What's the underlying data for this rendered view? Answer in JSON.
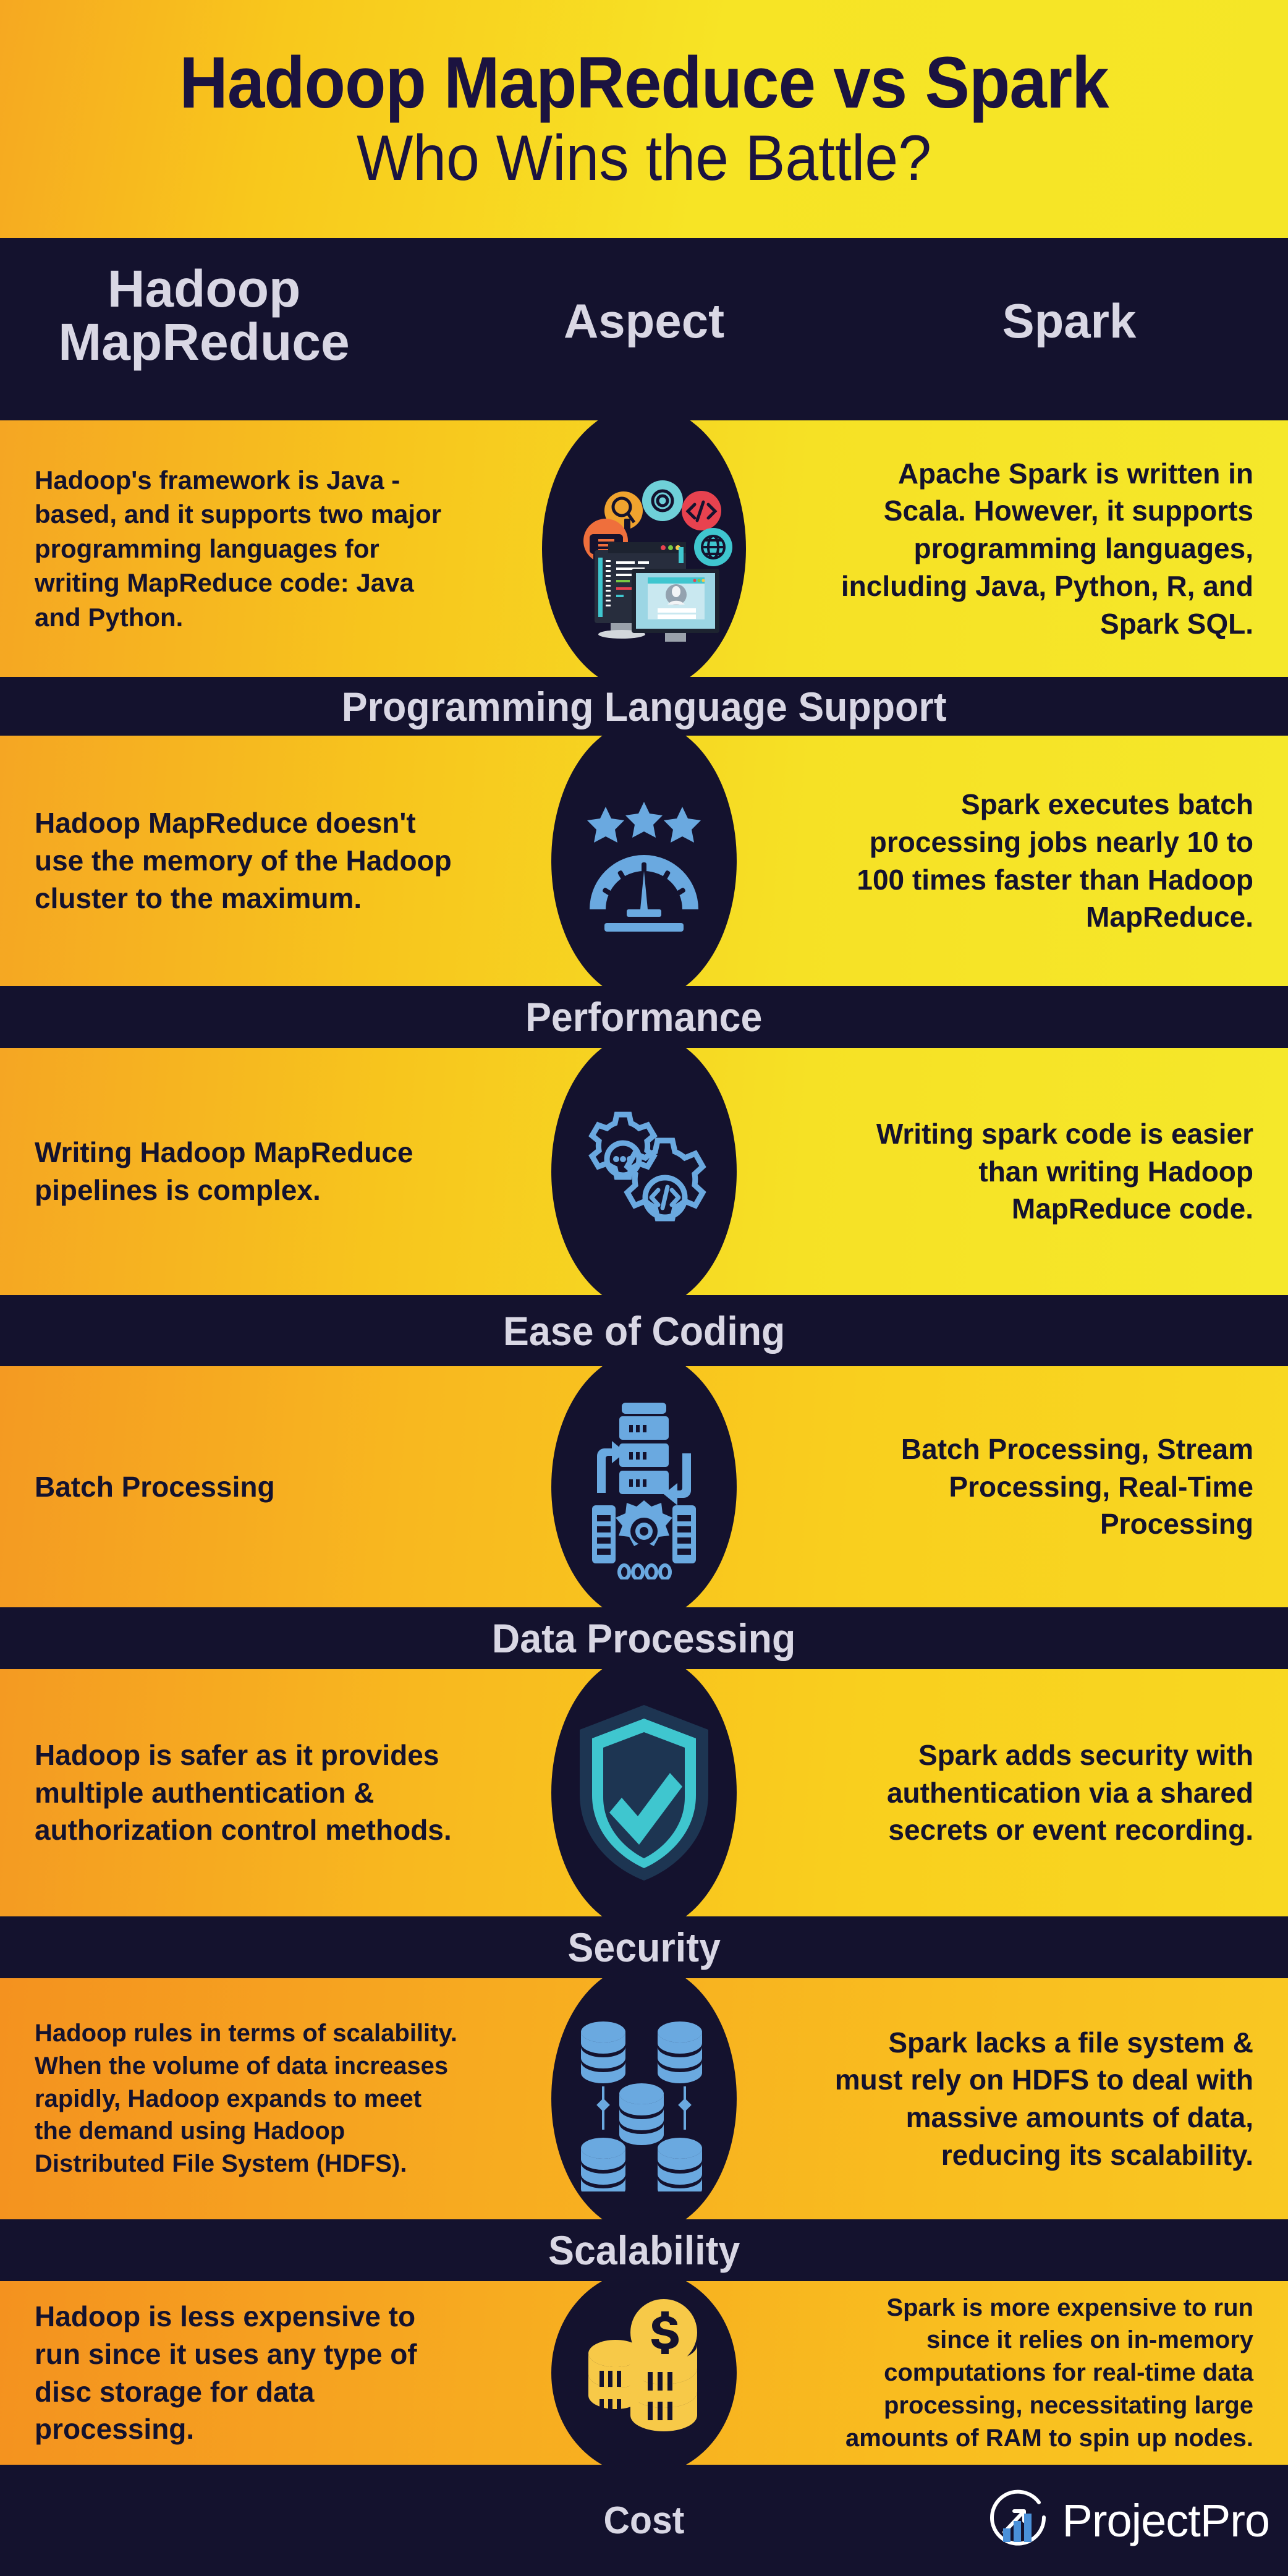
{
  "header": {
    "title": "Hadoop MapReduce vs Spark",
    "subtitle": "Who Wins the Battle?"
  },
  "columns": {
    "left": "Hadoop\nMapReduce",
    "left_line1": "Hadoop",
    "left_line2": "MapReduce",
    "middle": "Aspect",
    "right": "Spark"
  },
  "colors": {
    "dark_navy": "#14122e",
    "title_text": "#1b1340",
    "heading_text": "#d9d7e4",
    "gradient_orange": "#f5a623",
    "gradient_yellow": "#f5e627",
    "icon_blue": "#6aa9e0",
    "icon_teal": "#45c8d4",
    "coin_gold": "#f7c948"
  },
  "rows": [
    {
      "aspect": "Programming Language Support",
      "icon": "coding-workstation-icon",
      "hadoop": "Hadoop's framework is Java -based, and it supports two major programming languages for writing MapReduce code: Java and Python.",
      "spark": "Apache Spark is written in Scala. However, it supports programming languages, including Java, Python, R, and Spark SQL."
    },
    {
      "aspect": "Performance",
      "icon": "speedometer-icon",
      "hadoop": "Hadoop MapReduce doesn't use the memory of the Hadoop cluster to the maximum.",
      "spark": "Spark executes batch processing jobs nearly 10 to 100 times faster than Hadoop MapReduce."
    },
    {
      "aspect": "Ease of Coding",
      "icon": "gears-code-icon",
      "hadoop": "Writing Hadoop MapReduce pipelines is complex.",
      "spark": "Writing spark code is easier than writing Hadoop MapReduce code."
    },
    {
      "aspect": "Data Processing",
      "icon": "server-pipeline-icon",
      "hadoop": "Batch Processing",
      "spark": "Batch Processing, Stream Processing, Real-Time Processing"
    },
    {
      "aspect": "Security",
      "icon": "shield-check-icon",
      "hadoop": "Hadoop is safer as it provides multiple authentication & authorization control methods.",
      "spark": "Spark adds security with authentication via a shared secrets or event recording."
    },
    {
      "aspect": "Scalability",
      "icon": "database-cluster-icon",
      "hadoop": "Hadoop rules in terms of scalability. When the volume of data increases rapidly, Hadoop expands to meet the demand using Hadoop Distributed File System (HDFS).",
      "spark": "Spark lacks a file system & must rely on HDFS to deal with massive amounts of data, reducing its scalability."
    },
    {
      "aspect": "Cost",
      "icon": "coin-stack-icon",
      "hadoop": "Hadoop is less expensive to run since it uses any type of disc storage for data processing.",
      "spark": "Spark is more expensive to run since it relies on in-memory computations for real-time data processing, necessitating large amounts of RAM to spin up nodes."
    }
  ],
  "footer": {
    "aspect_label": "Cost",
    "brand": "ProjectPro",
    "brand_icon": "growth-chart-circle-icon"
  }
}
